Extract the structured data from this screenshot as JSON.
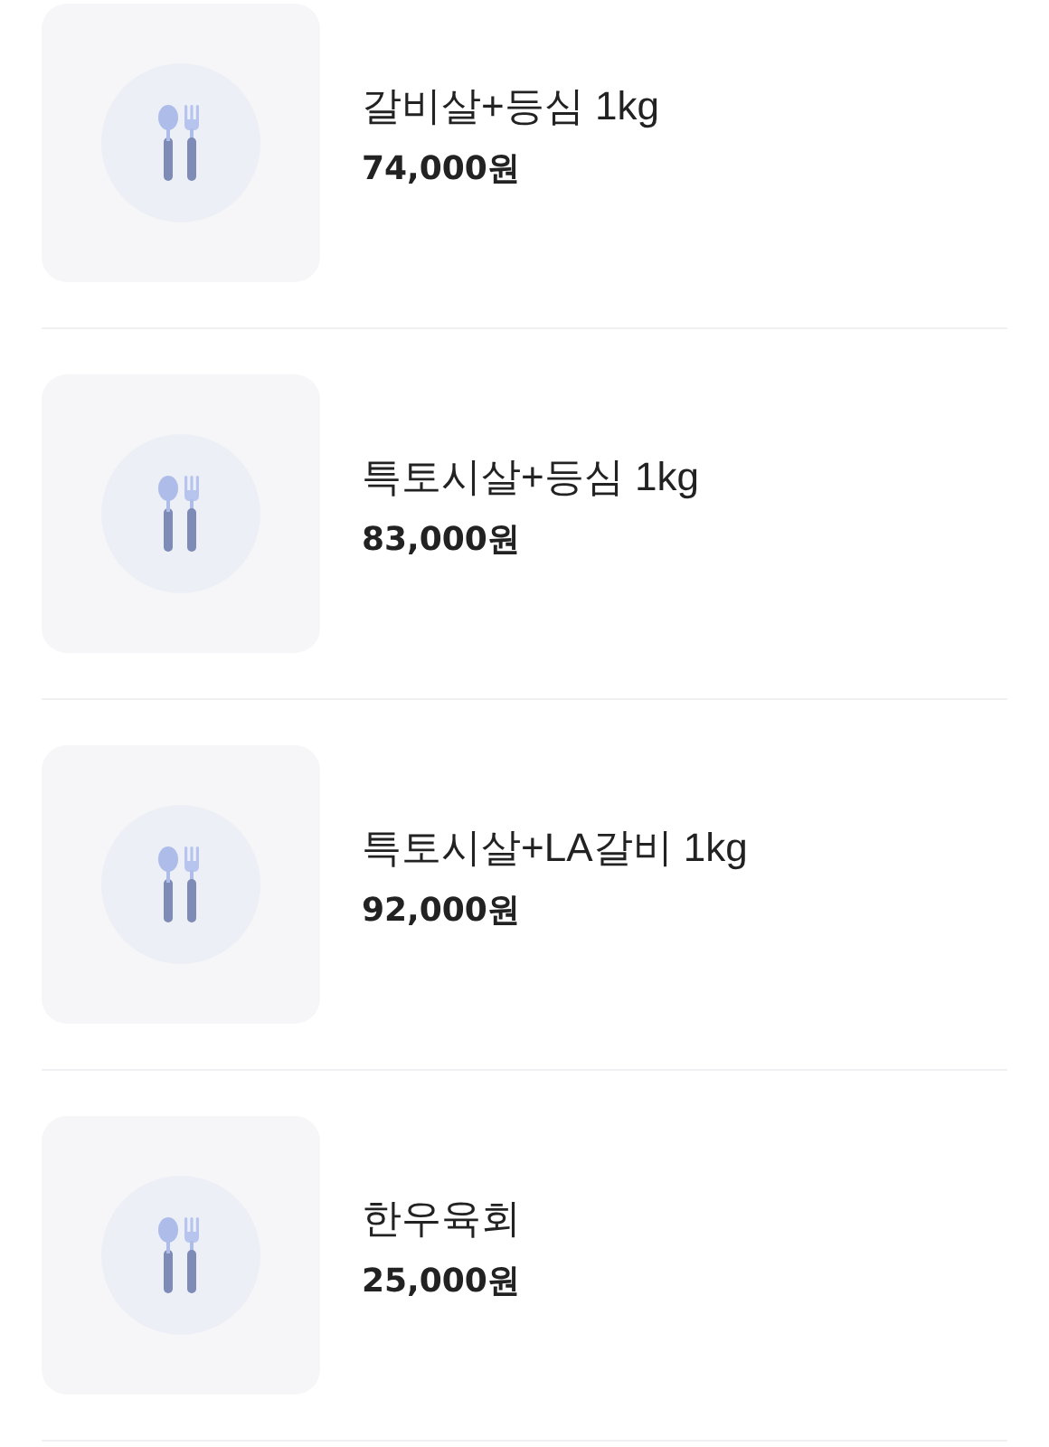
{
  "items": [
    {
      "name": "갈비살+등심 1kg",
      "price": "74,000원"
    },
    {
      "name": "특토시살+등심 1kg",
      "price": "83,000원"
    },
    {
      "name": "특토시살+LA갈비 1kg",
      "price": "92,000원"
    },
    {
      "name": "한우육회",
      "price": "25,000원"
    }
  ]
}
